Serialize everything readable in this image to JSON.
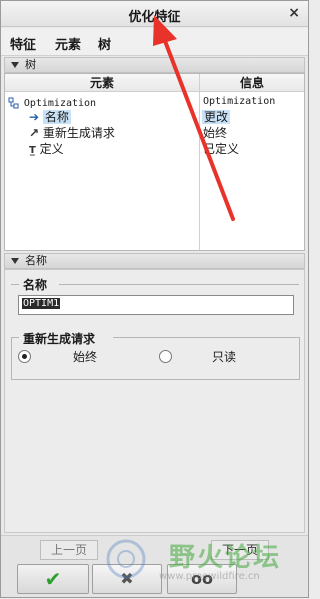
{
  "dialog": {
    "title": "优化特征",
    "close_glyph": "×"
  },
  "menu": [
    {
      "label": "特征"
    },
    {
      "label": "元素"
    },
    {
      "label": "树"
    }
  ],
  "tree_section": {
    "header": "树",
    "col_element": "元素",
    "col_info": "信息",
    "rows": [
      {
        "element": "Optimization",
        "info": "Optimization"
      },
      {
        "element": "名称",
        "info": "更改",
        "selected": true
      },
      {
        "element": "重新生成请求",
        "info": "始终"
      },
      {
        "element": "定义",
        "info": "已定义"
      }
    ]
  },
  "name_section": {
    "header": "名称",
    "group_label": "名称",
    "value": "OPTIM1"
  },
  "regen_section": {
    "group_label": "重新生成请求",
    "options": [
      {
        "label": "始终",
        "selected": true
      },
      {
        "label": "只读",
        "selected": false
      }
    ]
  },
  "footer": {
    "prev_label": "上一页",
    "next_label": "下一页",
    "ok_glyph": "✔",
    "cancel_glyph": "✖",
    "preview_glyph": "oo"
  },
  "watermark": {
    "text": "野火论坛",
    "url": "www.proewildfire.cn"
  },
  "colors": {
    "annotation_arrow": "#e8332a",
    "ok_check": "#2e9e2e",
    "selection": "#c9e1f7"
  }
}
